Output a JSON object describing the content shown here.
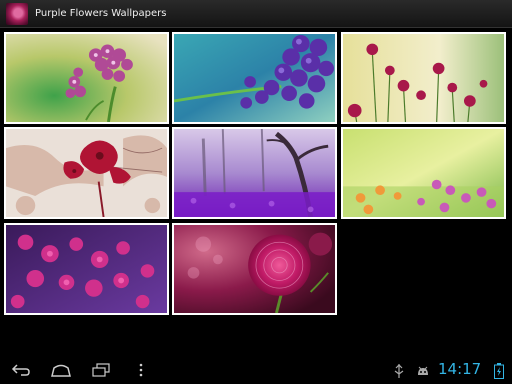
{
  "app": {
    "title": "Purple Flowers Wallpapers",
    "icon": "flower-app-icon"
  },
  "wallpapers": [
    {
      "name": "wallpaper-pink-hydrangea",
      "row": 1,
      "col": 1
    },
    {
      "name": "wallpaper-blue-purple-berries",
      "row": 1,
      "col": 2
    },
    {
      "name": "wallpaper-clover-meadow",
      "row": 1,
      "col": 3
    },
    {
      "name": "wallpaper-grunge-rose",
      "row": 2,
      "col": 1
    },
    {
      "name": "wallpaper-purple-misty-forest",
      "row": 2,
      "col": 2
    },
    {
      "name": "wallpaper-sunny-flower-field",
      "row": 2,
      "col": 3
    },
    {
      "name": "wallpaper-purple-blossoms",
      "row": 3,
      "col": 1
    },
    {
      "name": "wallpaper-magenta-dahlia",
      "row": 3,
      "col": 2
    }
  ],
  "statusbar": {
    "time": "14:17",
    "icons": [
      "back-icon",
      "home-icon",
      "recent-apps-icon",
      "menu-icon",
      "usb-icon",
      "android-debug-icon",
      "battery-charging-icon"
    ]
  },
  "colors": {
    "clock": "#33b5e5",
    "titlebar": "#1e1e1e",
    "background": "#000000"
  }
}
